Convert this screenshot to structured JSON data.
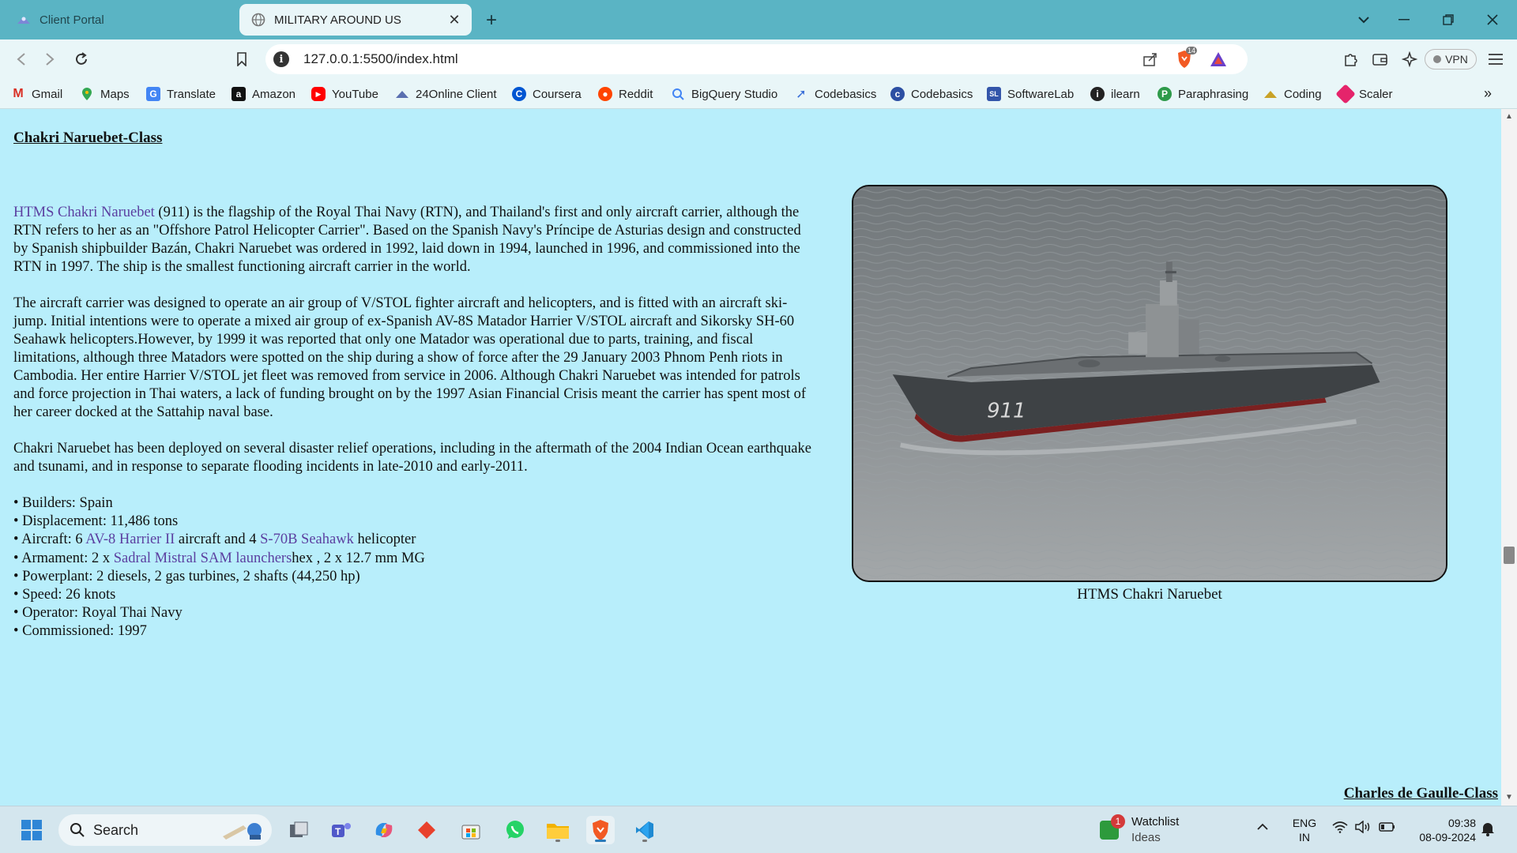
{
  "browser": {
    "tabs": [
      {
        "label": "Client Portal",
        "active": false
      },
      {
        "label": "MILITARY AROUND US",
        "active": true
      }
    ],
    "url": "127.0.0.1:5500/index.html",
    "brave_badge": "14",
    "vpn_label": "VPN"
  },
  "bookmarks": [
    {
      "label": "Gmail",
      "icon": "gmail-icon",
      "color": "#d93025"
    },
    {
      "label": "Maps",
      "icon": "maps-icon",
      "color": "#34a853"
    },
    {
      "label": "Translate",
      "icon": "translate-icon",
      "color": "#4285f4"
    },
    {
      "label": "Amazon",
      "icon": "amazon-icon",
      "color": "#111111"
    },
    {
      "label": "YouTube",
      "icon": "youtube-icon",
      "color": "#ff0000"
    },
    {
      "label": "24Online Client",
      "icon": "24online-icon",
      "color": "#5a6fb0"
    },
    {
      "label": "Coursera",
      "icon": "coursera-icon",
      "color": "#0056d2"
    },
    {
      "label": "Reddit",
      "icon": "reddit-icon",
      "color": "#ff4500"
    },
    {
      "label": "BigQuery Studio",
      "icon": "bigquery-icon",
      "color": "#4285f4"
    },
    {
      "label": "Codebasics",
      "icon": "codebasics-rocket-icon",
      "color": "#3a6fd8"
    },
    {
      "label": "Codebasics",
      "icon": "codebasics-icon",
      "color": "#2c4fa3"
    },
    {
      "label": "SoftwareLab",
      "icon": "softwarelab-icon",
      "color": "#3355aa"
    },
    {
      "label": "ilearn",
      "icon": "ilearn-icon",
      "color": "#222222"
    },
    {
      "label": "Paraphrasing",
      "icon": "paraphrasing-icon",
      "color": "#2e9a4a"
    },
    {
      "label": "Coding",
      "icon": "coding-icon",
      "color": "#c9a227"
    },
    {
      "label": "Scaler",
      "icon": "scaler-icon",
      "color": "#e5246b"
    }
  ],
  "page": {
    "heading": "Chakri Naruebet-Class",
    "p1_link": "HTMS Chakri Naruebet",
    "p1_text": " (911) is the flagship of the Royal Thai Navy (RTN), and Thailand's first and only aircraft carrier, although the RTN refers to her as an \"Offshore Patrol Helicopter Carrier\". Based on the Spanish Navy's Príncipe de Asturias design and constructed by Spanish shipbuilder Bazán, Chakri Naruebet was ordered in 1992, laid down in 1994, launched in 1996, and commissioned into the RTN in 1997. The ship is the smallest functioning aircraft carrier in the world.",
    "p2": "The aircraft carrier was designed to operate an air group of V/STOL fighter aircraft and helicopters, and is fitted with an aircraft ski-jump. Initial intentions were to operate a mixed air group of ex-Spanish AV-8S Matador Harrier V/STOL aircraft and Sikorsky SH-60 Seahawk helicopters.However, by 1999 it was reported that only one Matador was operational due to parts, training, and fiscal limitations, although three Matadors were spotted on the ship during a show of force after the 29 January 2003 Phnom Penh riots in Cambodia. Her entire Harrier V/STOL jet fleet was removed from service in 2006. Although Chakri Naruebet was intended for patrols and force projection in Thai waters, a lack of funding brought on by the 1997 Asian Financial Crisis meant the carrier has spent most of her career docked at the Sattahip naval base.",
    "p3": "Chakri Naruebet has been deployed on several disaster relief operations, including in the aftermath of the 2004 Indian Ocean earthquake and tsunami, and in response to separate flooding incidents in late-2010 and early-2011.",
    "specs": {
      "builders": "• Builders: Spain",
      "displacement": "• Displacement: 11,486 tons",
      "aircraft_prefix": "• Aircraft: 6 ",
      "aircraft_link1": "AV-8 Harrier II",
      "aircraft_mid": " aircraft and 4 ",
      "aircraft_link2": "S-70B Seahawk",
      "aircraft_suffix": " helicopter",
      "armament_prefix": "• Armament: 2 x ",
      "armament_link": "Sadral Mistral SAM launchers",
      "armament_suffix": "hex , 2 x 12.7 mm MG",
      "powerplant": "• Powerplant: 2 diesels, 2 gas turbines, 2 shafts (44,250 hp)",
      "speed": "• Speed: 26 knots",
      "operator": "• Operator: Royal Thai Navy",
      "commissioned": "• Commissioned: 1997"
    },
    "figure_caption": "HTMS Chakri Naruebet",
    "hull_number": "911",
    "next_heading": "Charles de Gaulle-Class"
  },
  "taskbar": {
    "search_label": "Search",
    "watchlist_title": "Watchlist",
    "watchlist_sub": "Ideas",
    "watchlist_badge": "1",
    "lang_line1": "ENG",
    "lang_line2": "IN",
    "time": "09:38",
    "date": "08-09-2024"
  },
  "colors": {
    "page_background": "#b8eefb",
    "tab_strip": "#5ab4c4",
    "link": "#5b3fa0"
  }
}
